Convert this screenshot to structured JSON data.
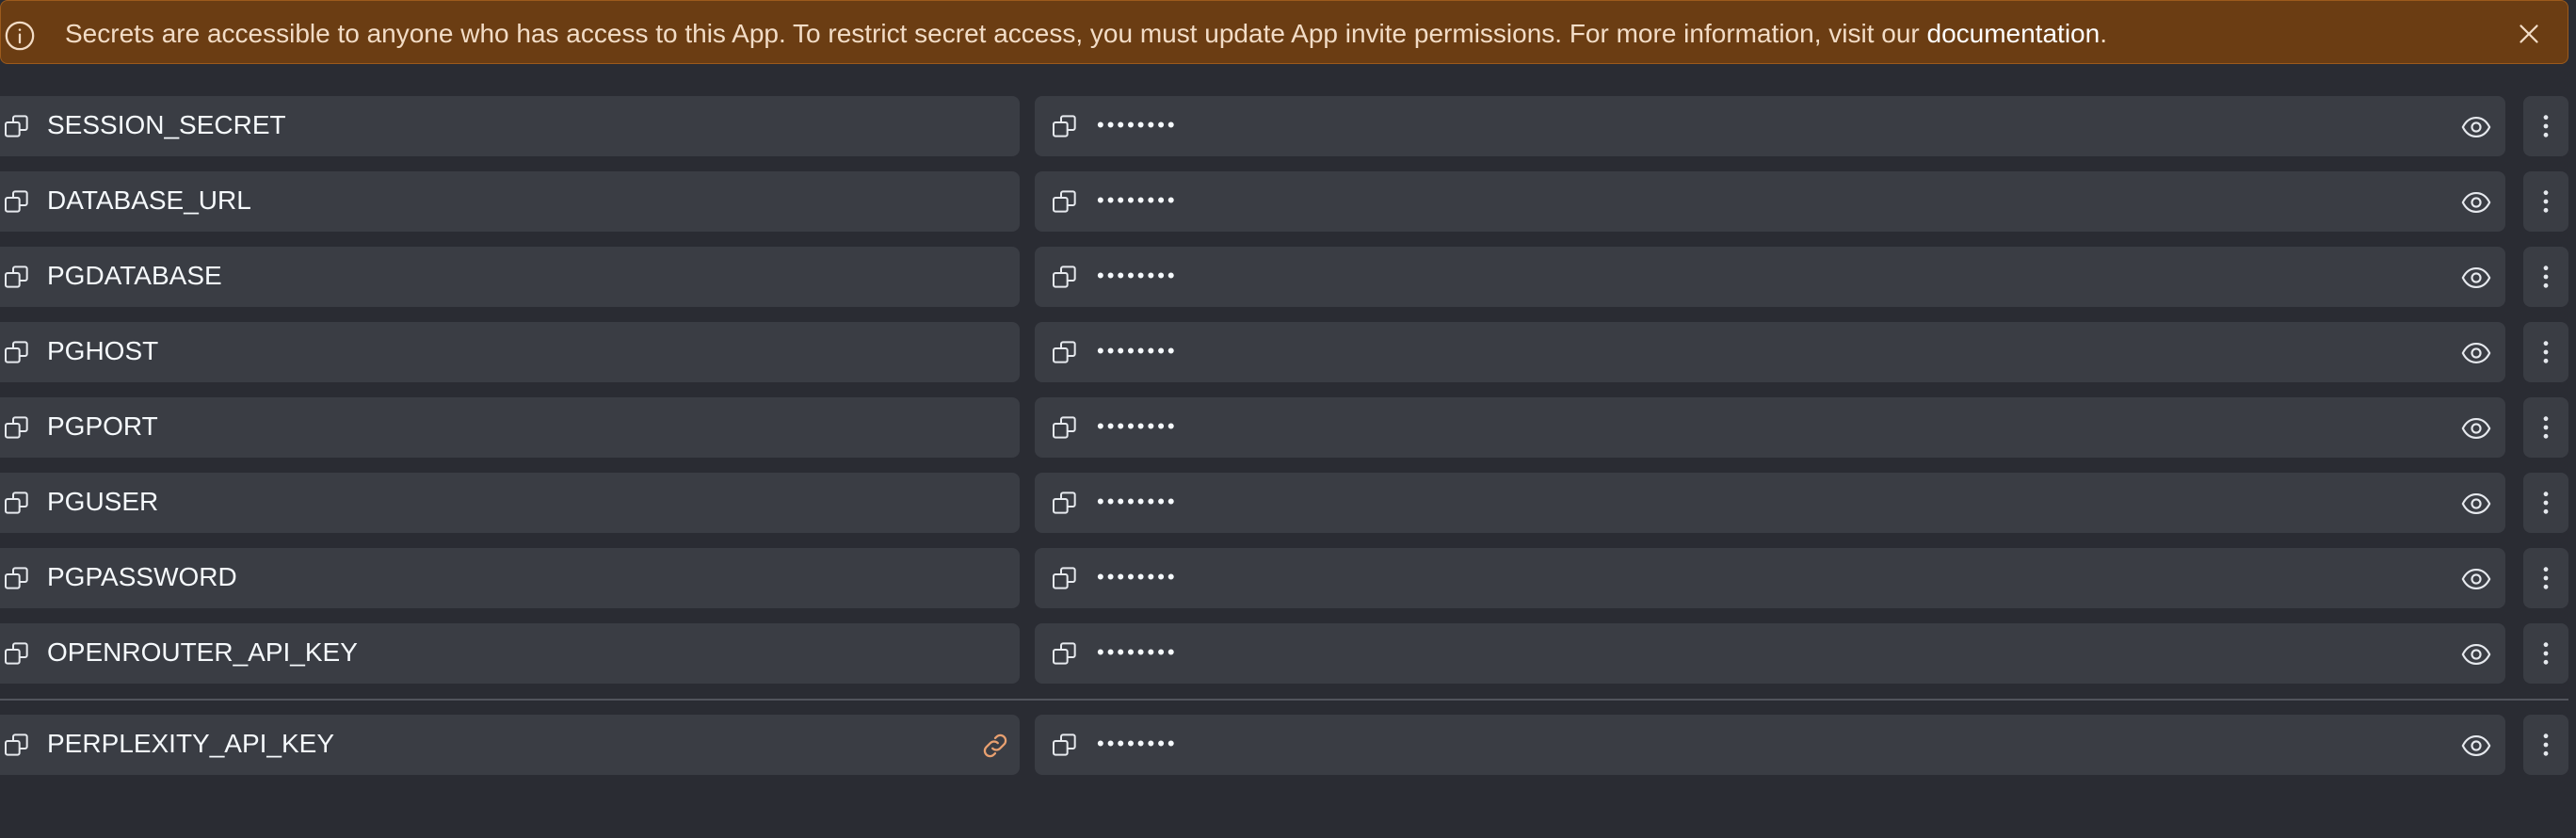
{
  "banner": {
    "message": "Secrets are accessible to anyone who has access to this App. To restrict secret access, you must update App invite permissions. For more information, visit our ",
    "link_label": "documentation",
    "message_end": "."
  },
  "secrets": [
    {
      "key": "SESSION_SECRET",
      "value_masked": "••••••••"
    },
    {
      "key": "DATABASE_URL",
      "value_masked": "••••••••"
    },
    {
      "key": "PGDATABASE",
      "value_masked": "••••••••"
    },
    {
      "key": "PGHOST",
      "value_masked": "••••••••"
    },
    {
      "key": "PGPORT",
      "value_masked": "••••••••"
    },
    {
      "key": "PGUSER",
      "value_masked": "••••••••"
    },
    {
      "key": "PGPASSWORD",
      "value_masked": "••••••••"
    },
    {
      "key": "OPENROUTER_API_KEY",
      "value_masked": "••••••••"
    }
  ],
  "linked_secrets": [
    {
      "key": "PERPLEXITY_API_KEY",
      "value_masked": "••••••••"
    }
  ],
  "colors": {
    "banner_bg": "#6b3d13",
    "link_icon": "#e8a070",
    "row_bg": "#3a3d44",
    "page_bg": "#2a2c33"
  }
}
